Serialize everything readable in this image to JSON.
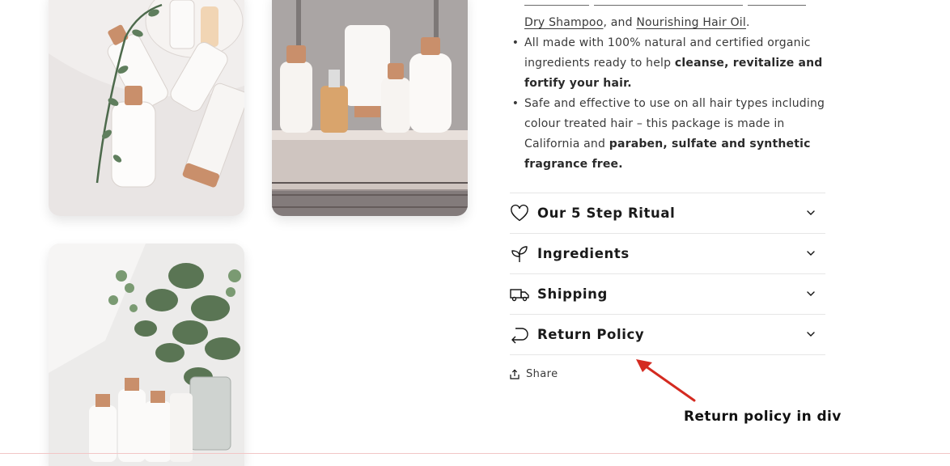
{
  "description": {
    "links": {
      "dry_shampoo": "Dry Shampoo",
      "hair_oil": "Nourishing Hair Oil"
    },
    "line1_and": ", and ",
    "line1_end": ".",
    "bullet_char": "•",
    "bullet1": {
      "line1": "All made with 100% natural and certified organic",
      "line2_plain": "ingredients ready to help ",
      "line2_bold": "cleanse, revitalize and",
      "line3_bold": "fortify your hair."
    },
    "bullet2": {
      "line1": "Safe and effective to use on all hair types including",
      "line2": "colour treated hair – this package is made in",
      "line3_plain": "California and ",
      "line3_bold": "paraben, sulfate and synthetic",
      "line4_bold": "fragrance free."
    }
  },
  "accordion": [
    {
      "label": "Our 5 Step Ritual",
      "icon": "heart-icon"
    },
    {
      "label": "Ingredients",
      "icon": "leaf-icon"
    },
    {
      "label": "Shipping",
      "icon": "truck-icon"
    },
    {
      "label": "Return Policy",
      "icon": "return-arrow-icon"
    }
  ],
  "share": {
    "label": "Share",
    "icon": "share-icon"
  },
  "annotation": {
    "text": "Return policy in div",
    "color": "#d42a20"
  },
  "colors": {
    "text": "#121212",
    "muted": "#3a3a3a",
    "divider": "#e6e6e6",
    "annotation_arrow": "#d42a20"
  }
}
